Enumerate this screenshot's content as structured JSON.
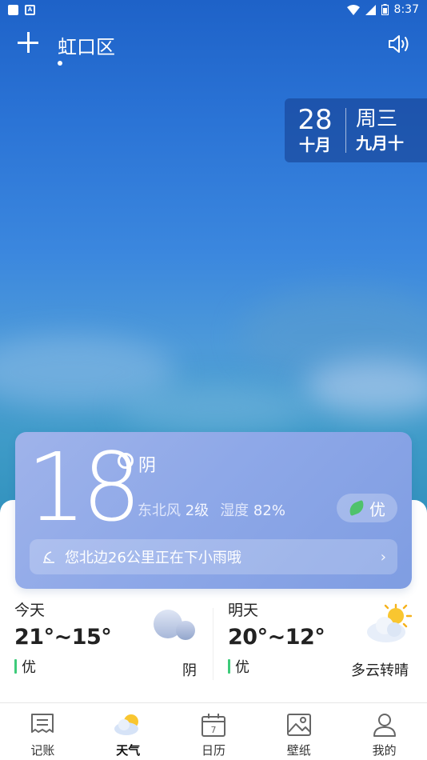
{
  "status_bar": {
    "time": "8:37"
  },
  "header": {
    "city": "虹口区"
  },
  "date": {
    "day": "28",
    "month": "十月",
    "weekday": "周三",
    "lunar": "九月十"
  },
  "current": {
    "temperature": "18",
    "condition": "阴",
    "wind_label": "东北风",
    "wind_level": "2级",
    "humidity_label": "湿度",
    "humidity_value": "82%",
    "aqi": "优",
    "rain_notice": "您北边26公里正在下小雨哦"
  },
  "forecast": {
    "today": {
      "label": "今天",
      "range": "21°~15°",
      "aqi": "优",
      "condition": "阴",
      "icon": "cloudy-icon"
    },
    "tomorrow": {
      "label": "明天",
      "range": "20°~12°",
      "aqi": "优",
      "condition": "多云转晴",
      "icon": "partly-sunny-icon"
    }
  },
  "tabs": [
    {
      "label": "记账",
      "icon": "ledger-icon"
    },
    {
      "label": "天气",
      "icon": "weather-icon",
      "active": true
    },
    {
      "label": "日历",
      "icon": "calendar-icon",
      "badge": "7"
    },
    {
      "label": "壁纸",
      "icon": "wallpaper-icon"
    },
    {
      "label": "我的",
      "icon": "profile-icon"
    }
  ],
  "colors": {
    "sky_top": "#1e62c8",
    "card": "#8ea8e8",
    "aqi_green": "#3ecb7a"
  }
}
